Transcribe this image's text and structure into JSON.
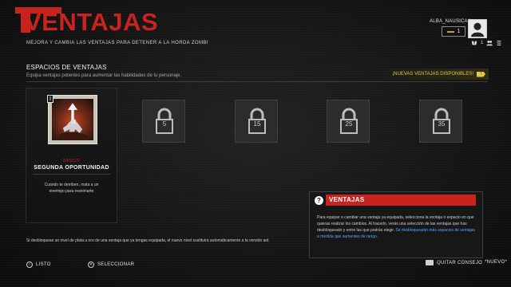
{
  "header": {
    "title": "VENTAJAS",
    "subtitle": "MEJORA Y CAMBIA LAS VENTAJAS PARA DETENER A LA HORDA ZOMBI"
  },
  "profile": {
    "name": "ALBA_NAUSICAA",
    "coins": "1",
    "secondary_count": "1",
    "icons": [
      "avatar-icon",
      "controller-icon",
      "currency-icon",
      "friends-icon",
      "options-icon"
    ]
  },
  "section": {
    "title": "ESPACIOS DE VENTAJAS",
    "description": "Equipa ventajas potentes para aumentar las habilidades de tu personaje.",
    "new_perks_label": "¡NUEVAS VENTAJAS DISPONIBLES!",
    "new_perks_tag": "!"
  },
  "perk": {
    "level": "I",
    "rank": "BÁSICO",
    "name": "SEGUNDA OPORTUNIDAD",
    "description": "Cuando te derriben, mata a un enemigo para reanimarte"
  },
  "slots": [
    {
      "level": "5"
    },
    {
      "level": "15"
    },
    {
      "level": "25"
    },
    {
      "level": "35"
    }
  ],
  "warning": "Si desbloqueas un nivel de plata u oro de una ventaja que ya tengas equipada, el nuevo nivel sustituirá automáticamente a la versión ant",
  "tooltip": {
    "icon": "?",
    "title": "VENTAJAS",
    "body": "Para equipar o cambiar una ventaja ya equipada, selecciona la ventaja o espacio en que quieras realizar los cambios. Al hacerlo, verás una selección de las ventajas que has desbloqueado y entre las que podrás elegir.",
    "highlight": "Se desbloquearán más espacios de ventajas a medida que aumentes de rango."
  },
  "footer": {
    "ready_label": "LISTO",
    "select_label": "SELECCIONAR",
    "remove_tip_label": "QUITAR CONSEJO",
    "new_label": "*NUEVO*"
  },
  "colors": {
    "accent_red": "#c8231f",
    "highlight_blue": "#5aa7ff",
    "new_yellow": "#e4c74a"
  }
}
